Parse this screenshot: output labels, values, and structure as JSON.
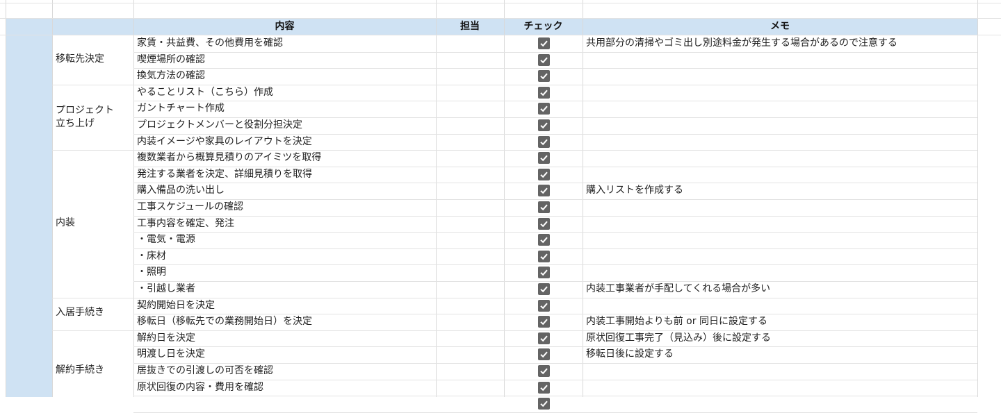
{
  "header": {
    "content": "内容",
    "assignee": "担当",
    "check": "チェック",
    "memo": "メモ"
  },
  "categories": [
    {
      "label": "移転先決定"
    },
    {
      "label": "プロジェクト\n立ち上げ"
    },
    {
      "label": "内装"
    },
    {
      "label": "入居手続き"
    },
    {
      "label": "解約手続き"
    }
  ],
  "rows": [
    {
      "task": "家賃・共益費、その他費用を確認",
      "checked": true,
      "memo": "共用部分の清掃やゴミ出し別途料金が発生する場合があるので注意する"
    },
    {
      "task": "喫煙場所の確認",
      "checked": true,
      "memo": ""
    },
    {
      "task": "換気方法の確認",
      "checked": true,
      "memo": ""
    },
    {
      "task": "やることリスト（こちら）作成",
      "checked": true,
      "memo": ""
    },
    {
      "task": "ガントチャート作成",
      "checked": true,
      "memo": ""
    },
    {
      "task": "プロジェクトメンバーと役割分担決定",
      "checked": true,
      "memo": ""
    },
    {
      "task": "内装イメージや家具のレイアウトを決定",
      "checked": true,
      "memo": ""
    },
    {
      "task": "複数業者から概算見積りのアイミツを取得",
      "checked": true,
      "memo": ""
    },
    {
      "task": "発注する業者を決定、詳細見積りを取得",
      "checked": true,
      "memo": ""
    },
    {
      "task": "購入備品の洗い出し",
      "checked": true,
      "memo": "購入リストを作成する"
    },
    {
      "task": "工事スケジュールの確認",
      "checked": true,
      "memo": ""
    },
    {
      "task": "工事内容を確定、発注",
      "checked": true,
      "memo": ""
    },
    {
      "task": "・電気・電源",
      "checked": true,
      "memo": ""
    },
    {
      "task": "・床材",
      "checked": true,
      "memo": ""
    },
    {
      "task": "・照明",
      "checked": true,
      "memo": ""
    },
    {
      "task": "・引越し業者",
      "checked": true,
      "memo": "内装工事業者が手配してくれる場合が多い"
    },
    {
      "task": "契約開始日を決定",
      "checked": true,
      "memo": ""
    },
    {
      "task": "移転日（移転先での業務開始日）を決定",
      "checked": true,
      "memo": "内装工事開始よりも前 or 同日に設定する"
    },
    {
      "task": "解約日を決定",
      "checked": true,
      "memo": "原状回復工事完了（見込み）後に設定する"
    },
    {
      "task": "明渡し日を決定",
      "checked": true,
      "memo": "移転日後に設定する"
    },
    {
      "task": "居抜きでの引渡しの可否を確認",
      "checked": true,
      "memo": ""
    },
    {
      "task": "原状回復の内容・費用を確認",
      "checked": true,
      "memo": ""
    },
    {
      "task": "",
      "checked": true,
      "memo": ""
    }
  ],
  "colors": {
    "header_bg": "#cfe2f3",
    "grid": "#e2e2e2",
    "checkbox": "#646464"
  }
}
